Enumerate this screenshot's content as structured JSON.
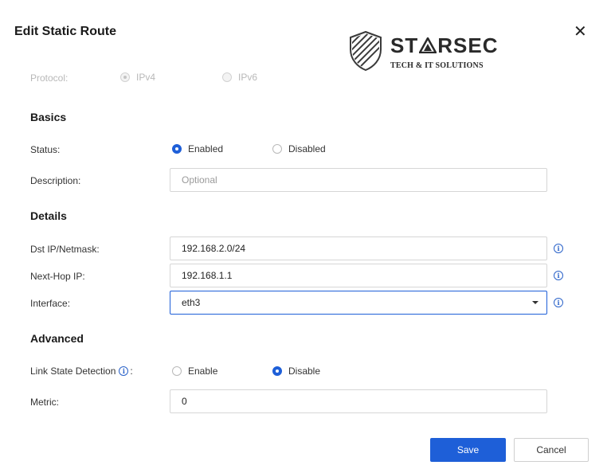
{
  "dialog": {
    "title": "Edit Static Route",
    "close_label": "✕"
  },
  "logo": {
    "name_part1": "ST",
    "name_part2": "RSEC",
    "tagline": "TECH & IT SOLUTIONS"
  },
  "protocol": {
    "label": "Protocol:",
    "options": [
      "IPv4",
      "IPv6"
    ],
    "selected": "IPv4"
  },
  "basics": {
    "heading": "Basics",
    "status": {
      "label": "Status:",
      "options": [
        "Enabled",
        "Disabled"
      ],
      "selected": "Enabled"
    },
    "description": {
      "label": "Description:",
      "value": "",
      "placeholder": "Optional"
    }
  },
  "details": {
    "heading": "Details",
    "dst": {
      "label": "Dst IP/Netmask:",
      "value": "192.168.2.0/24"
    },
    "nexthop": {
      "label": "Next-Hop IP:",
      "value": "192.168.1.1"
    },
    "interface": {
      "label": "Interface:",
      "value": "eth3"
    }
  },
  "advanced": {
    "heading": "Advanced",
    "link_state": {
      "label": "Link State Detection",
      "suffix": ":",
      "options": [
        "Enable",
        "Disable"
      ],
      "selected": "Disable"
    },
    "metric": {
      "label": "Metric:",
      "value": "0"
    }
  },
  "buttons": {
    "save": "Save",
    "cancel": "Cancel"
  },
  "colors": {
    "accent": "#1e5fd8",
    "info": "#2a62c9",
    "disabled_text": "#b8b8b8"
  }
}
